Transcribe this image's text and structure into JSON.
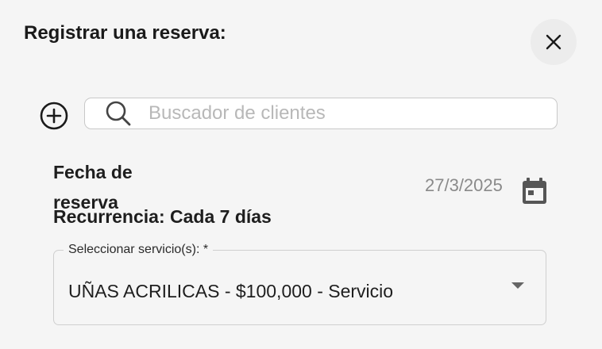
{
  "dialog": {
    "title": "Registrar una reserva:",
    "close_icon": "close-icon"
  },
  "client_search": {
    "add_icon": "plus-circle-icon",
    "search_icon": "search-icon",
    "placeholder": "Buscador de clientes",
    "value": ""
  },
  "booking_date": {
    "label": "Fecha de reserva",
    "value": "27/3/2025",
    "calendar_icon": "calendar-icon"
  },
  "recurrence": {
    "text": "Recurrencia: Cada 7 días"
  },
  "service_select": {
    "label": "Seleccionar servicio(s): *",
    "selected": "UÑAS ACRILICAS - $100,000 - Servicio",
    "arrow_icon": "dropdown-arrow-icon"
  }
}
